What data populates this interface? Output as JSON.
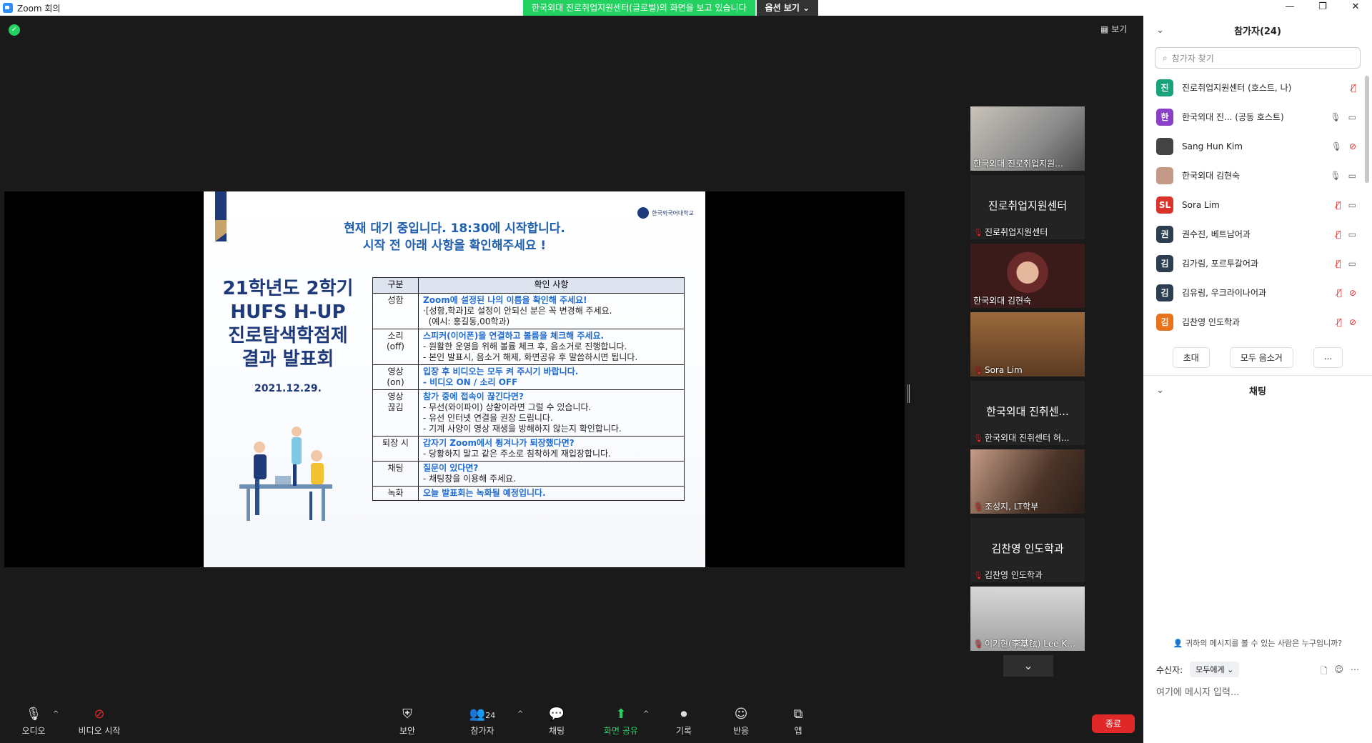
{
  "window": {
    "title": "Zoom 회의",
    "controls": [
      "—",
      "❐",
      "✕"
    ]
  },
  "share_banner": {
    "message": "한국외대 진로취업지원센터(글로벌)의 화면을 보고 있습니다",
    "options_label": "옵션 보기 ⌄"
  },
  "meeting": {
    "view_label": "보기"
  },
  "slide": {
    "logo_text": "한국외국어대학교",
    "header_line1": "현재 대기 중입니다. 18:30에 시작합니다.",
    "header_line2": "시작 전 아래 사항을 확인해주세요 !",
    "title_line1": "21학년도 2학기",
    "title_line2": "HUFS H-UP",
    "title_line3": "진로탐색학점제",
    "title_line4": "결과 발표회",
    "date": "2021.12.29.",
    "table_headers": [
      "구분",
      "확인 사항"
    ],
    "rows": [
      {
        "cat": "성함",
        "blue": "Zoom에 설정된 나의 이름을 확인해 주세요!",
        "lines": [
          "·[성함,학과]로 설정이 안되신 분은 꼭 변경해 주세요.",
          "  (예시: 홍길동,00학과)"
        ]
      },
      {
        "cat": "소리\n(off)",
        "blue": "스피커(이어폰)을 연결하고 볼륨을 체크해 주세요.",
        "lines": [
          "- 원활한 운영을 위해 볼륨 체크 후, 음소거로 진행합니다.",
          "- 본인 발표시, 음소거 해제, 화면공유 후 말씀하시면 됩니다."
        ]
      },
      {
        "cat": "영상\n(on)",
        "blue": "입장 후 비디오는 모두 켜 주시기 바랍니다.",
        "lines": [
          "- 비디오 ON / 소리 OFF"
        ],
        "lines_blue": true
      },
      {
        "cat": "영상\n끊김",
        "blue": "참가 중에 접속이 끊긴다면?",
        "lines": [
          "- 무선(와이파이) 상황이라면 그럴 수 있습니다.",
          "- 유선 인터넷 연결을 권장 드립니다.",
          "- 기계 사양이 영상 재생을 방해하지 않는지 확인합니다."
        ]
      },
      {
        "cat": "퇴장 시",
        "blue": "갑자기 Zoom에서 튕겨나가 퇴장했다면?",
        "lines": [
          "- 당황하지 말고 같은 주소로 침착하게 재입장합니다."
        ]
      },
      {
        "cat": "채팅",
        "blue": "질문이 있다면?",
        "lines": [
          "- 채팅창을 이용해 주세요."
        ]
      },
      {
        "cat": "녹화",
        "blue": "오늘 발표회는 녹화될 예정입니다.",
        "lines": []
      }
    ]
  },
  "gallery": [
    {
      "name": "한국외대 진로취업지원...",
      "type": "video",
      "muted": false
    },
    {
      "name": "진로취업지원센터",
      "center": "진로취업지원센터",
      "type": "name",
      "muted": true
    },
    {
      "name": "한국외대 김현숙",
      "type": "video",
      "muted": false
    },
    {
      "name": "Sora Lim",
      "type": "video",
      "muted": true
    },
    {
      "name": "한국외대 진취센터 허...",
      "center": "한국외대 진취센...",
      "type": "name",
      "muted": true
    },
    {
      "name": "조성지, LT학부",
      "type": "video",
      "muted": true
    },
    {
      "name": "김찬영 인도학과",
      "center": "김찬영 인도학과",
      "type": "name",
      "muted": true
    },
    {
      "name": "이기현(李基铉) Lee K...",
      "type": "video",
      "muted": true
    }
  ],
  "toolbar": {
    "audio": "오디오",
    "video": "비디오 시작",
    "security": "보안",
    "participants": "참가자",
    "participants_count": "24",
    "chat": "채팅",
    "share": "화면 공유",
    "record": "기록",
    "reactions": "반응",
    "apps": "앱",
    "end": "종료"
  },
  "panel": {
    "participants_title": "참가자(24)",
    "search_placeholder": "참가자 찾기",
    "participants": [
      {
        "initial": "진",
        "color": "#1aa37a",
        "name": "진로취업지원센터 (호스트, 나)",
        "mic": "muted",
        "cam": ""
      },
      {
        "initial": "한",
        "color": "#8a3fc7",
        "name": "한국외대 진...  (공동 호스트)",
        "mic": "on",
        "cam": "on"
      },
      {
        "initial": "",
        "color": "#444444",
        "name": "Sang Hun Kim",
        "mic": "on",
        "cam": "off"
      },
      {
        "initial": "",
        "color": "#c49a86",
        "name": "한국외대 김현숙",
        "mic": "on",
        "cam": "on"
      },
      {
        "initial": "SL",
        "color": "#d9332b",
        "name": "Sora Lim",
        "mic": "muted",
        "cam": "on"
      },
      {
        "initial": "권",
        "color": "#2c3e50",
        "name": "권수진, 베트남어과",
        "mic": "muted",
        "cam": "on"
      },
      {
        "initial": "김",
        "color": "#2c3e50",
        "name": "김가림, 포르투갈어과",
        "mic": "muted",
        "cam": "on"
      },
      {
        "initial": "김",
        "color": "#2c3e50",
        "name": "김유림, 우크라이나어과",
        "mic": "muted",
        "cam": "off"
      },
      {
        "initial": "김",
        "color": "#e8731c",
        "name": "김찬영 인도학과",
        "mic": "muted",
        "cam": "off"
      }
    ],
    "invite": "초대",
    "mute_all": "모두 음소거",
    "more": "...",
    "chat_title": "채팅",
    "who_sees": "귀하의 메시지를 볼 수 있는 사람은 누구입니까?",
    "recipient_label": "수신자:",
    "recipient_value": "모두에게 ⌄",
    "chat_placeholder": "여기에 메시지 입력..."
  }
}
